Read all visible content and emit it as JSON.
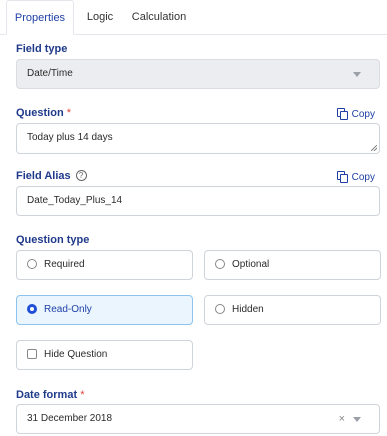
{
  "tabs": [
    "Properties",
    "Logic",
    "Calculation"
  ],
  "active_tab": "Properties",
  "field_type": {
    "label": "Field type",
    "value": "Date/Time"
  },
  "question": {
    "label": "Question",
    "required_mark": "*",
    "value": "Today plus 14 days",
    "copy_label": "Copy"
  },
  "field_alias": {
    "label": "Field Alias",
    "help": "?",
    "value": "Date_Today_Plus_14",
    "copy_label": "Copy"
  },
  "question_type": {
    "label": "Question type",
    "options": [
      "Required",
      "Optional",
      "Read-Only",
      "Hidden"
    ],
    "selected": "Read-Only"
  },
  "hide_question": {
    "label": "Hide Question",
    "checked": false
  },
  "date_format": {
    "label": "Date format",
    "required_mark": "*",
    "value": "31 December 2018",
    "clear": "×"
  },
  "colors": {
    "accent": "#1f3fa6",
    "required": "#e0463e",
    "selected_bg": "#eaf5fe"
  }
}
